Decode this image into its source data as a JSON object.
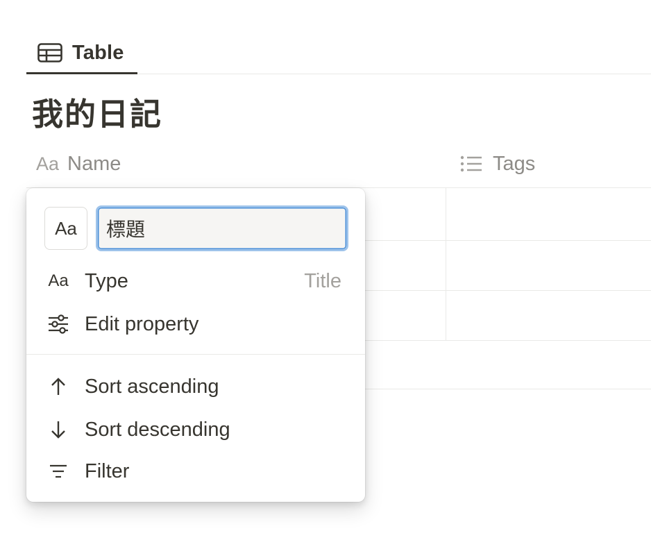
{
  "view_tab": {
    "label": "Table",
    "icon": "table-icon"
  },
  "database": {
    "title": "我的日記"
  },
  "columns": [
    {
      "label": "Name",
      "type_icon_text": "Aa",
      "icon": "text-type-icon"
    },
    {
      "label": "Tags",
      "icon": "list-icon"
    }
  ],
  "property_menu": {
    "type_button_text": "Aa",
    "name_value": "標題",
    "items": [
      {
        "label": "Type",
        "value": "Title",
        "icon": "text-type-icon",
        "icon_text": "Aa"
      },
      {
        "label": "Edit property",
        "icon": "sliders-icon"
      },
      {
        "label": "Sort ascending",
        "icon": "arrow-up-icon"
      },
      {
        "label": "Sort descending",
        "icon": "arrow-down-icon"
      },
      {
        "label": "Filter",
        "icon": "filter-icon"
      }
    ]
  },
  "colors": {
    "text": "#37352f",
    "muted": "#a3a19d",
    "border": "#e9e9e7",
    "focus": "#9ec3ea"
  }
}
